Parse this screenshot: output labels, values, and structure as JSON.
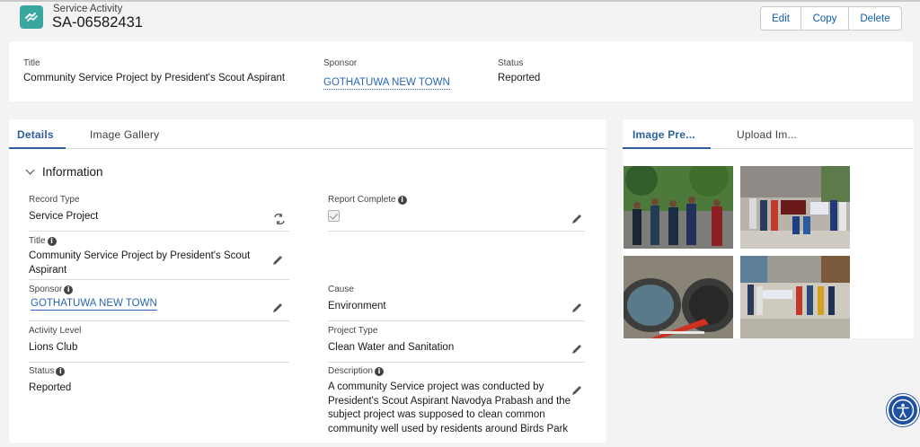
{
  "header": {
    "object_label": "Service Activity",
    "record_name": "SA-06582431",
    "actions": [
      "Edit",
      "Copy",
      "Delete"
    ]
  },
  "highlights": {
    "title_label": "Title",
    "title_value": "Community Service Project by President's Scout Aspirant",
    "sponsor_label": "Sponsor",
    "sponsor_value": "GOTHATUWA NEW TOWN",
    "status_label": "Status",
    "status_value": "Reported"
  },
  "tabs": {
    "details": "Details",
    "gallery": "Image Gallery"
  },
  "section": {
    "title": "Information"
  },
  "fields": {
    "record_type_label": "Record Type",
    "record_type_value": "Service Project",
    "report_complete_label": "Report Complete",
    "report_complete_checked": true,
    "title_label": "Title",
    "title_value_line1": "Community Service Project by President's Scout",
    "title_value_line2": "Aspirant",
    "sponsor_label": "Sponsor",
    "sponsor_value": "GOTHATUWA NEW TOWN",
    "cause_label": "Cause",
    "cause_value": "Environment",
    "activity_level_label": "Activity Level",
    "activity_level_value": "Lions Club",
    "project_type_label": "Project Type",
    "project_type_value": "Clean Water and Sanitation",
    "status_label": "Status",
    "status_value": "Reported",
    "description_label": "Description",
    "description_line1": "A community Service project was conducted by",
    "description_line2": "President's Scout Aspirant Navodya Prabash and the",
    "description_line3": "subject project was supposed to clean common",
    "description_line4": "community well used by residents around Birds Park"
  },
  "image_panel": {
    "tab_preview": "Image Pre...",
    "tab_upload": "Upload Im..."
  },
  "icons": {
    "header": "service-activity-icon",
    "edit": "pencil-icon",
    "change_record_type": "change-record-type-icon",
    "info": "info-icon",
    "accessibility": "accessibility-icon"
  },
  "colors": {
    "brand_icon": "#3aa79e",
    "link": "#2867b2",
    "active_tab": "#2c5f9e",
    "accessibility_button": "#1d4fa3"
  }
}
